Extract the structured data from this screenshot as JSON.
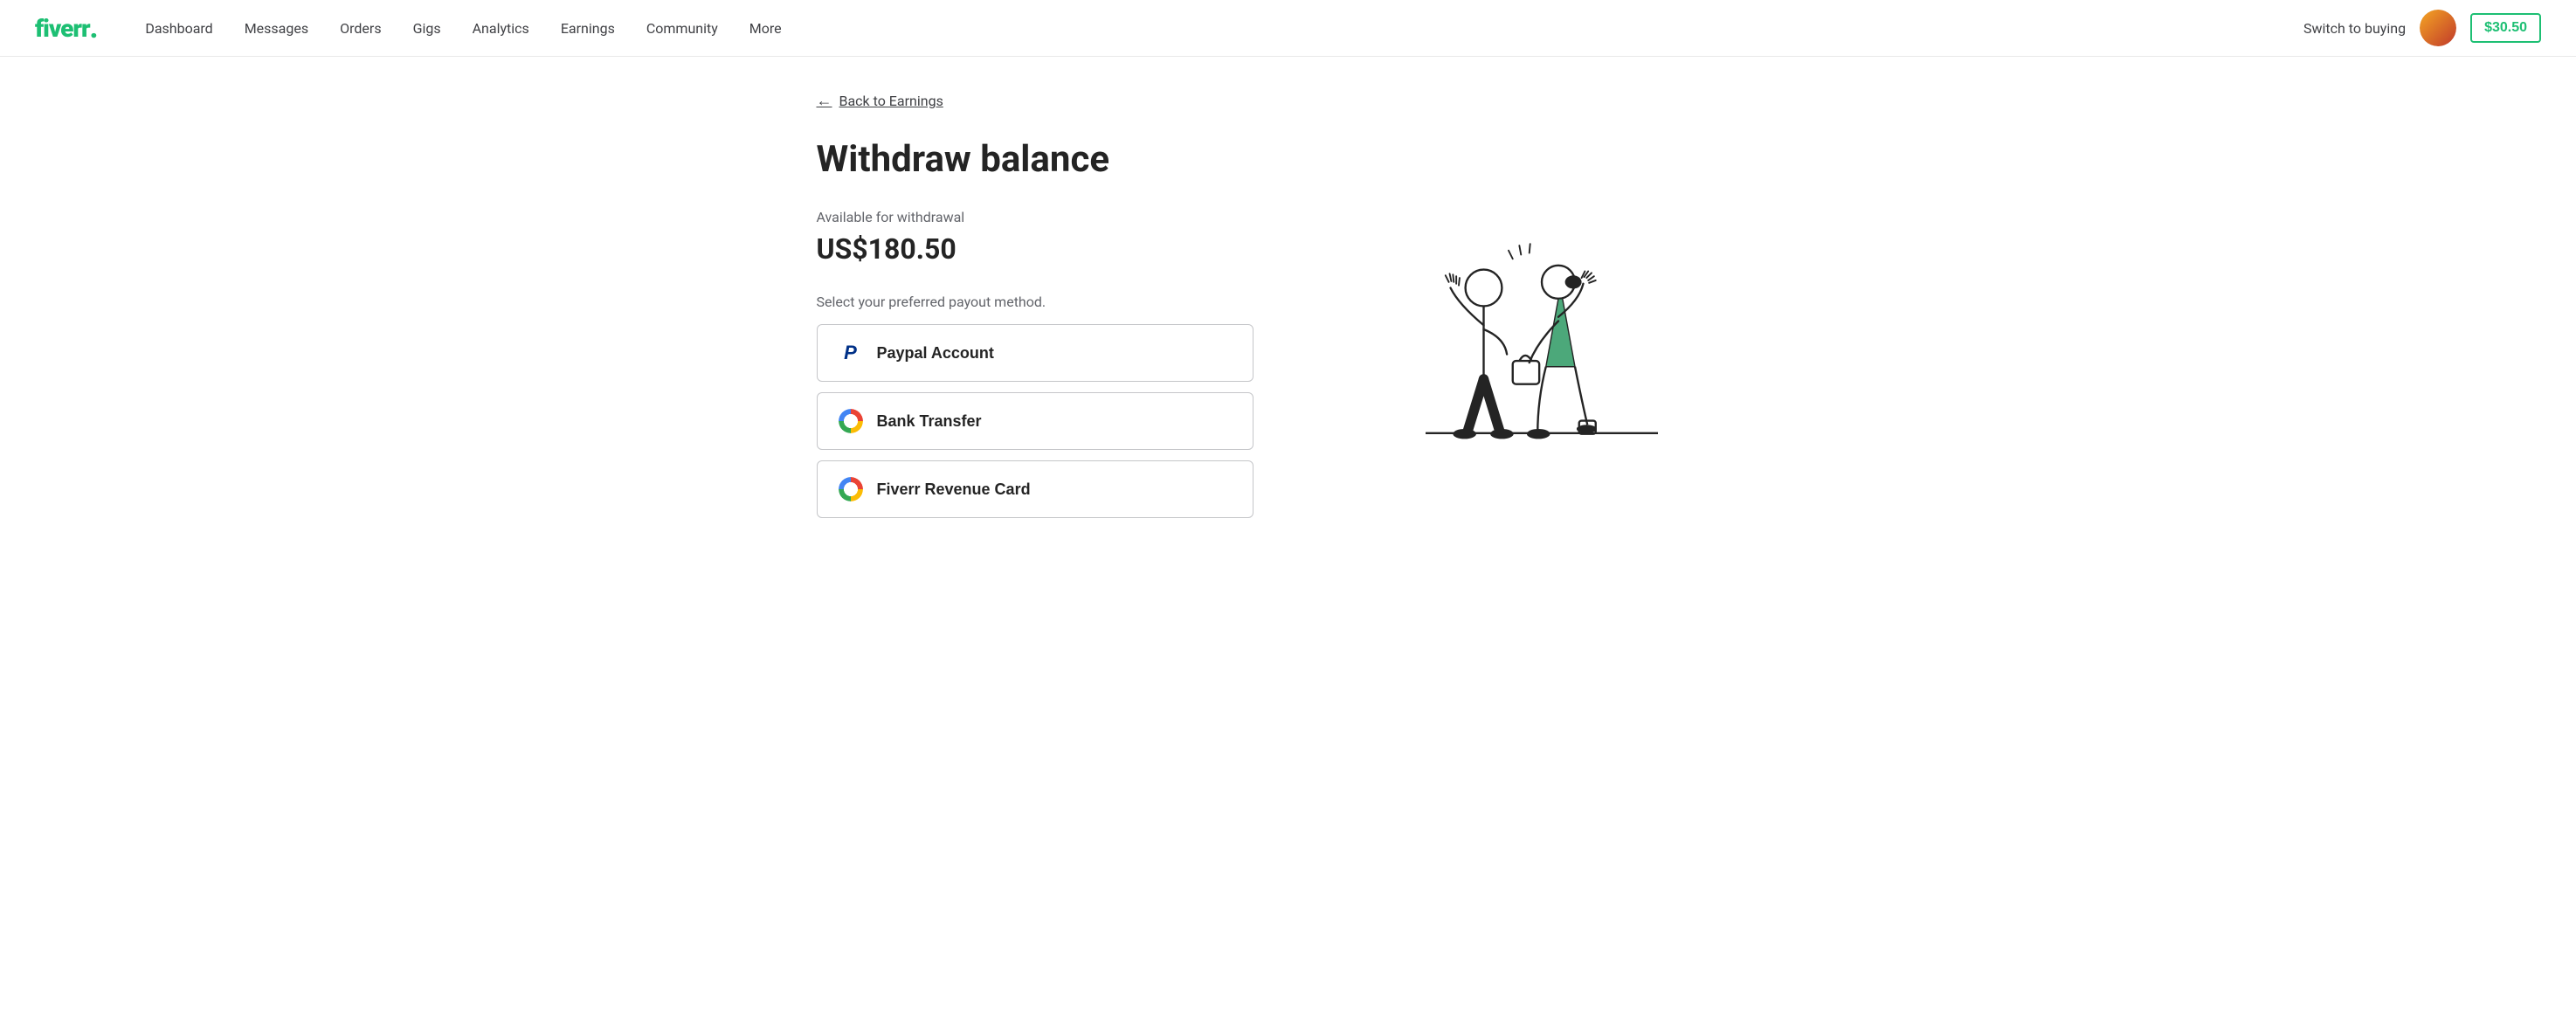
{
  "logo": {
    "text": "fiverr",
    "dot": "."
  },
  "nav": {
    "links": [
      {
        "label": "Dashboard",
        "id": "dashboard"
      },
      {
        "label": "Messages",
        "id": "messages"
      },
      {
        "label": "Orders",
        "id": "orders"
      },
      {
        "label": "Gigs",
        "id": "gigs"
      },
      {
        "label": "Analytics",
        "id": "analytics"
      },
      {
        "label": "Earnings",
        "id": "earnings"
      },
      {
        "label": "Community",
        "id": "community"
      },
      {
        "label": "More",
        "id": "more"
      }
    ],
    "switch_to_buying": "Switch to buying",
    "balance": "$30.50"
  },
  "page": {
    "back_link": "Back to Earnings",
    "title": "Withdraw balance",
    "available_label": "Available for withdrawal",
    "amount": "US$180.50",
    "select_label": "Select your preferred payout method.",
    "payout_methods": [
      {
        "id": "paypal",
        "label": "Paypal Account",
        "icon": "paypal"
      },
      {
        "id": "bank",
        "label": "Bank Transfer",
        "icon": "multicolor"
      },
      {
        "id": "fiverr-card",
        "label": "Fiverr Revenue Card",
        "icon": "multicolor"
      }
    ]
  }
}
